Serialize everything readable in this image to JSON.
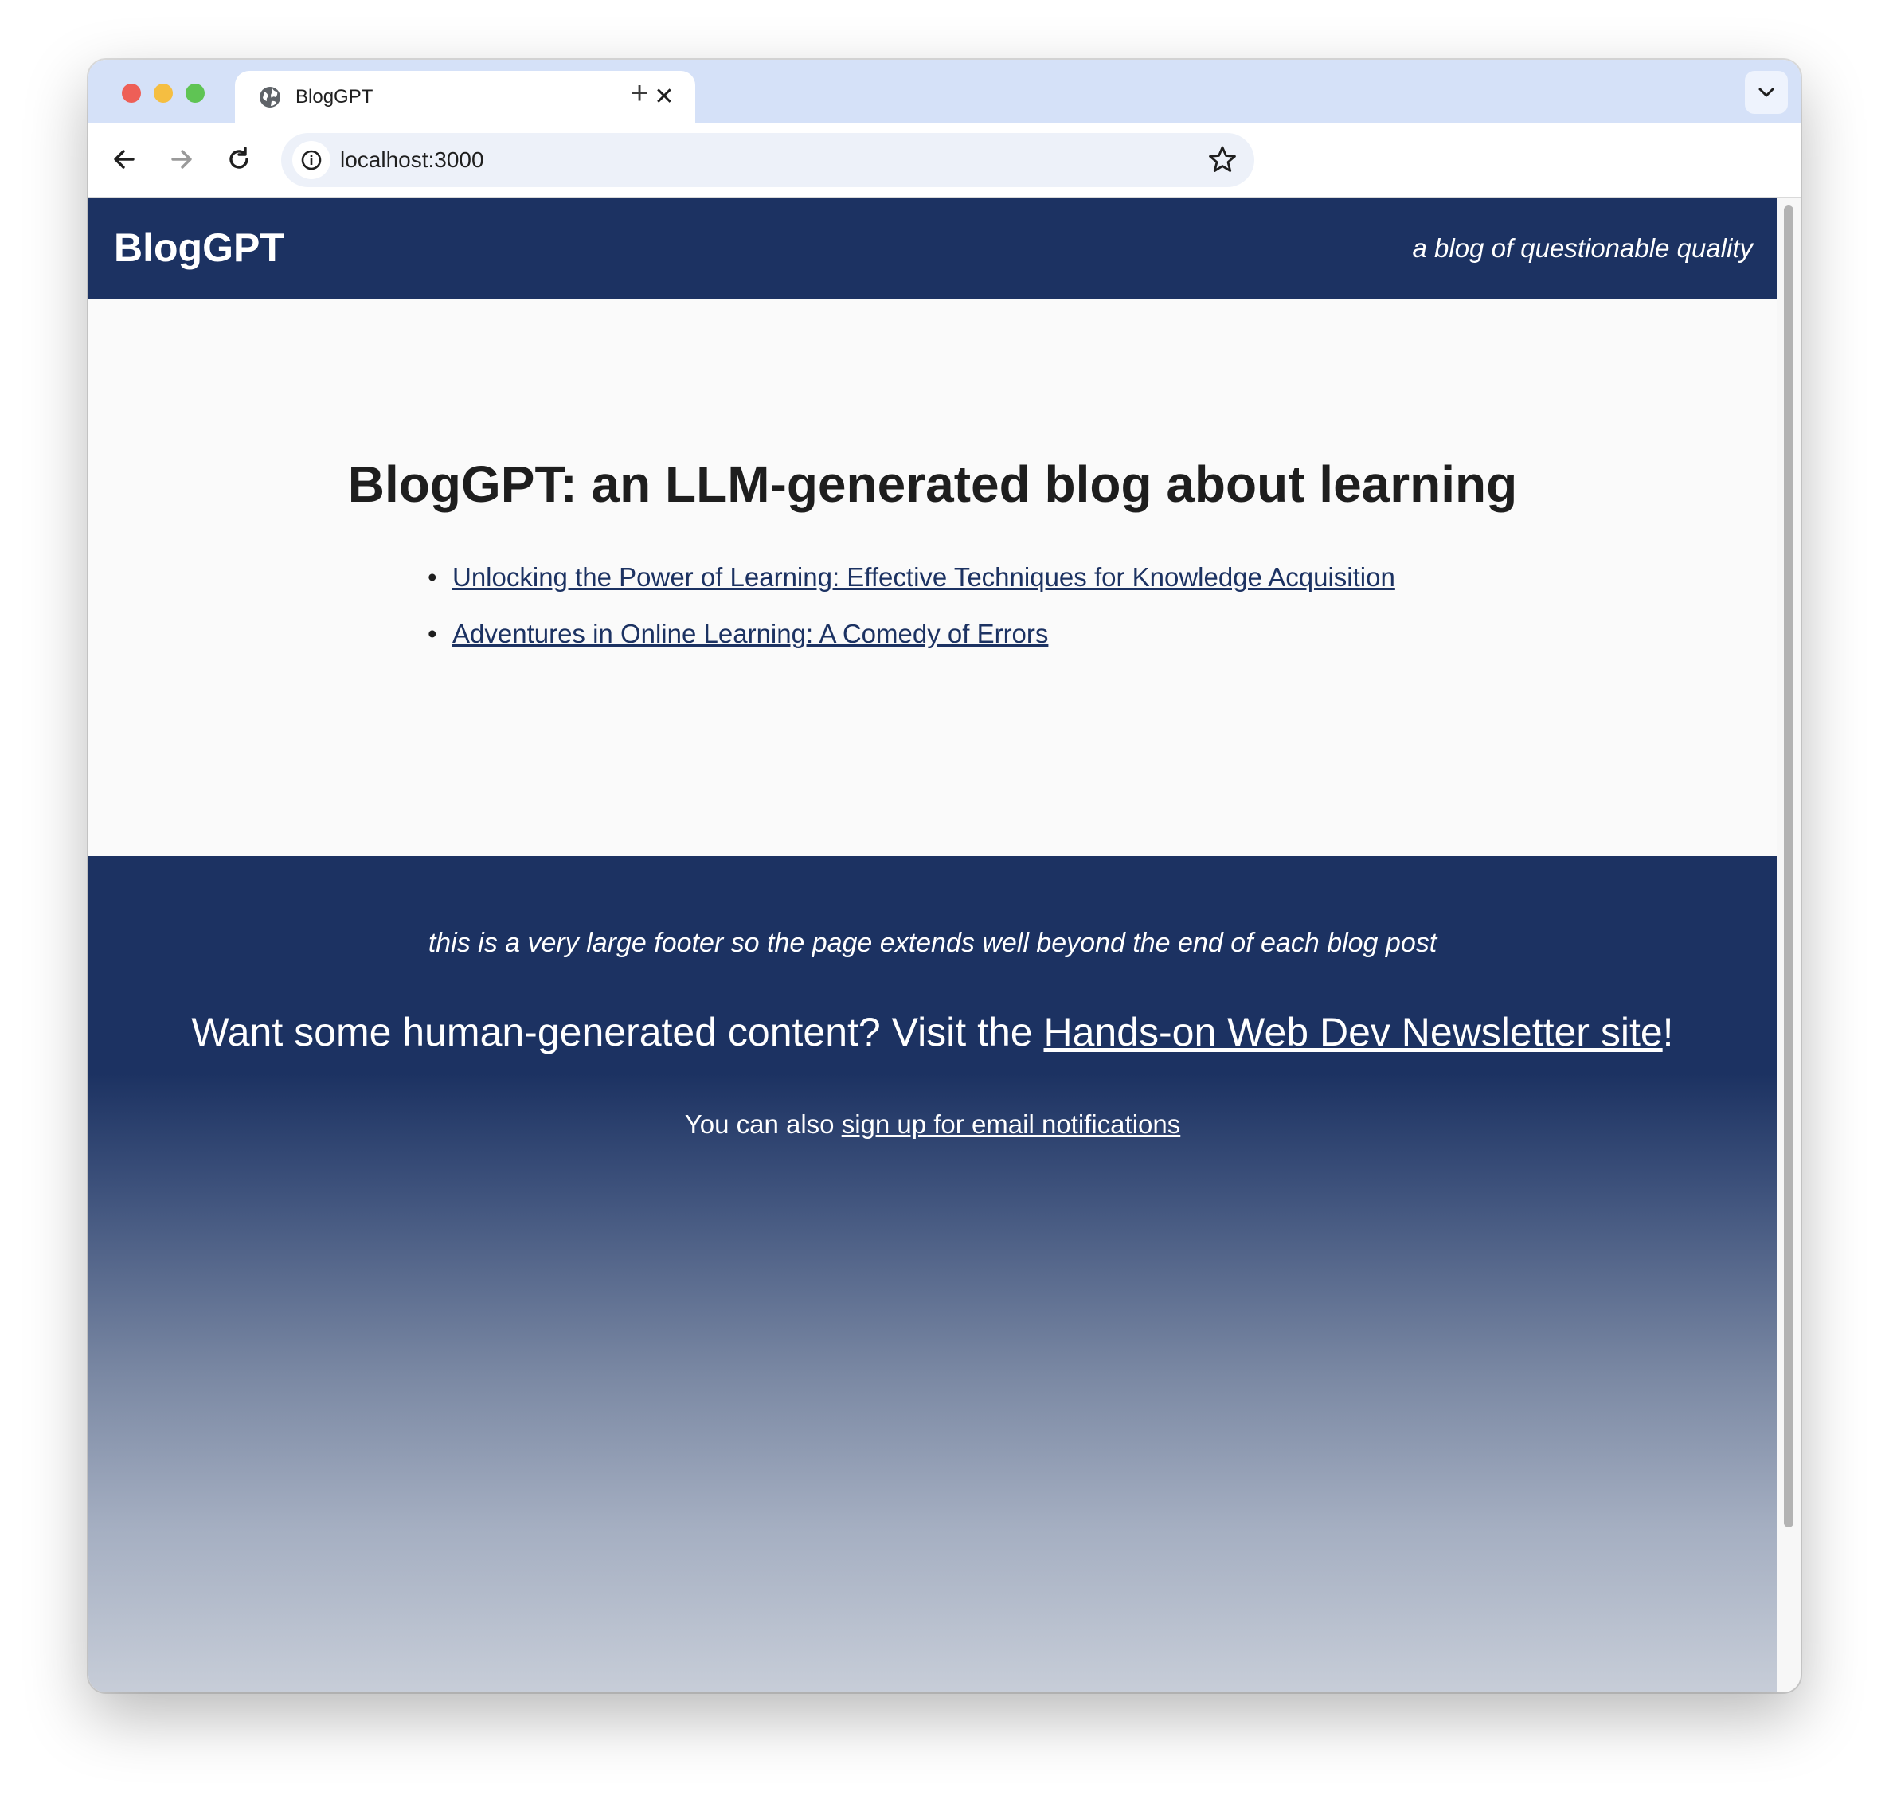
{
  "browser": {
    "tab_title": "BlogGPT",
    "url": "localhost:3000",
    "new_tab_symbol": "+",
    "close_symbol": "✕",
    "icons": {
      "tab": "globe-icon",
      "back": "back-arrow-icon",
      "forward": "forward-arrow-icon",
      "reload": "reload-icon",
      "site_info": "info-icon",
      "bookmark": "star-icon",
      "tab_menu": "chevron-down-icon"
    }
  },
  "header": {
    "brand": "BlogGPT",
    "tagline": "a blog of questionable quality",
    "background_color": "#1c3262"
  },
  "main": {
    "title": "BlogGPT: an LLM-generated blog about learning",
    "posts": [
      {
        "title": "Unlocking the Power of Learning: Effective Techniques for Knowledge Acquisition"
      },
      {
        "title": "Adventures in Online Learning: A Comedy of Errors"
      }
    ]
  },
  "footer": {
    "note": "this is a very large footer so the page extends well beyond the end of each blog post",
    "cta_prefix": "Want some human-generated content? Visit the ",
    "cta_link": "Hands-on Web Dev Newsletter site",
    "cta_suffix": "!",
    "sub_prefix": "You can also ",
    "sub_link": "sign up for email notifications"
  }
}
